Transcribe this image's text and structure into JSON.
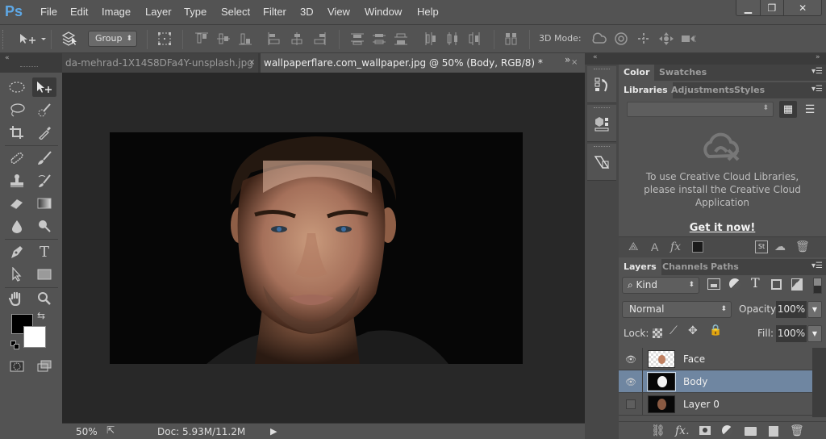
{
  "app": {
    "logo": "Ps"
  },
  "menu": [
    "File",
    "Edit",
    "Image",
    "Layer",
    "Type",
    "Select",
    "Filter",
    "3D",
    "View",
    "Window",
    "Help"
  ],
  "window_controls": {
    "minimize": "▁",
    "restore": "❐",
    "close": "✕"
  },
  "options_bar": {
    "move_tool_icon": "move-tool",
    "auto_select_icon": "auto-select-layers",
    "auto_select_value": "Group",
    "transform_controls_icon": "transform-controls",
    "align_icons": [
      "align-top-edges",
      "align-vertical-centers",
      "align-bottom-edges",
      "align-left-edges",
      "align-horizontal-centers",
      "align-right-edges"
    ],
    "distribute_icons": [
      "distribute-top",
      "distribute-vertical-centers",
      "distribute-bottom",
      "distribute-left",
      "distribute-horizontal-centers",
      "distribute-right"
    ],
    "auto_align_icon": "auto-align-layers",
    "mode_3d_label": "3D Mode:",
    "mode_3d_icons": [
      "orbit-3d",
      "roll-3d",
      "pan-3d",
      "slide-3d",
      "scale-3d"
    ]
  },
  "documents": {
    "tabs": [
      {
        "title": "da-mehrad-1X14S8DFa4Y-unsplash.jpg",
        "active": false
      },
      {
        "title": "wallpaperflare.com_wallpaper.jpg @ 50% (Body, RGB/8) *",
        "active": true
      }
    ],
    "close_glyph": "×",
    "overflow_glyph": "»"
  },
  "tools": [
    "elliptical-marquee",
    "move",
    "lasso",
    "quick-selection",
    "crop",
    "eyedropper",
    "spot-healing-brush",
    "brush",
    "clone-stamp",
    "history-brush",
    "eraser",
    "gradient",
    "blur",
    "dodge",
    "pen",
    "type",
    "path-selection",
    "rectangle",
    "hand",
    "zoom"
  ],
  "colors": {
    "foreground": "#000000",
    "background": "#ffffff",
    "accent_selection": "#6f86a1"
  },
  "status": {
    "zoom": "50%",
    "doc": "Doc: 5.93M/11.2M"
  },
  "dock": [
    "history-panel",
    "3d-panel",
    "properties-panel"
  ],
  "panels": {
    "color_group": {
      "tabs": [
        "Color",
        "Swatches"
      ],
      "active": "Color"
    },
    "library_group": {
      "tabs": [
        "Libraries",
        "Adjustments",
        "Styles"
      ],
      "active": "Libraries",
      "dropdown_value": "",
      "message": "To use Creative Cloud Libraries, please install the Creative Cloud Application",
      "message_lines": [
        "To use Creative Cloud Libraries,",
        "please install the Creative Cloud",
        "Application"
      ],
      "link": "Get it now!",
      "footer_icons": [
        "add-graphic",
        "add-character-style",
        "add-layer-style",
        "add-color",
        "stock",
        "cc-sync",
        "delete"
      ]
    },
    "layers_group": {
      "tabs": [
        "Layers",
        "Channels",
        "Paths"
      ],
      "active": "Layers",
      "filter_kind": "Kind",
      "filter_icons": [
        "pixel-filter",
        "adjustment-filter",
        "type-filter",
        "shape-filter",
        "smart-object-filter"
      ],
      "blend_mode": "Normal",
      "opacity_label": "Opacity:",
      "opacity": "100%",
      "lock_label": "Lock:",
      "fill_label": "Fill:",
      "fill": "100%",
      "layers": [
        {
          "name": "Face",
          "visible": true,
          "selected": false
        },
        {
          "name": "Body",
          "visible": true,
          "selected": true
        },
        {
          "name": "Layer 0",
          "visible": false,
          "selected": false
        }
      ],
      "footer_icons": [
        "link-layers",
        "add-layer-style",
        "add-mask",
        "new-adjustment-layer",
        "new-group",
        "new-layer",
        "delete-layer"
      ]
    }
  }
}
